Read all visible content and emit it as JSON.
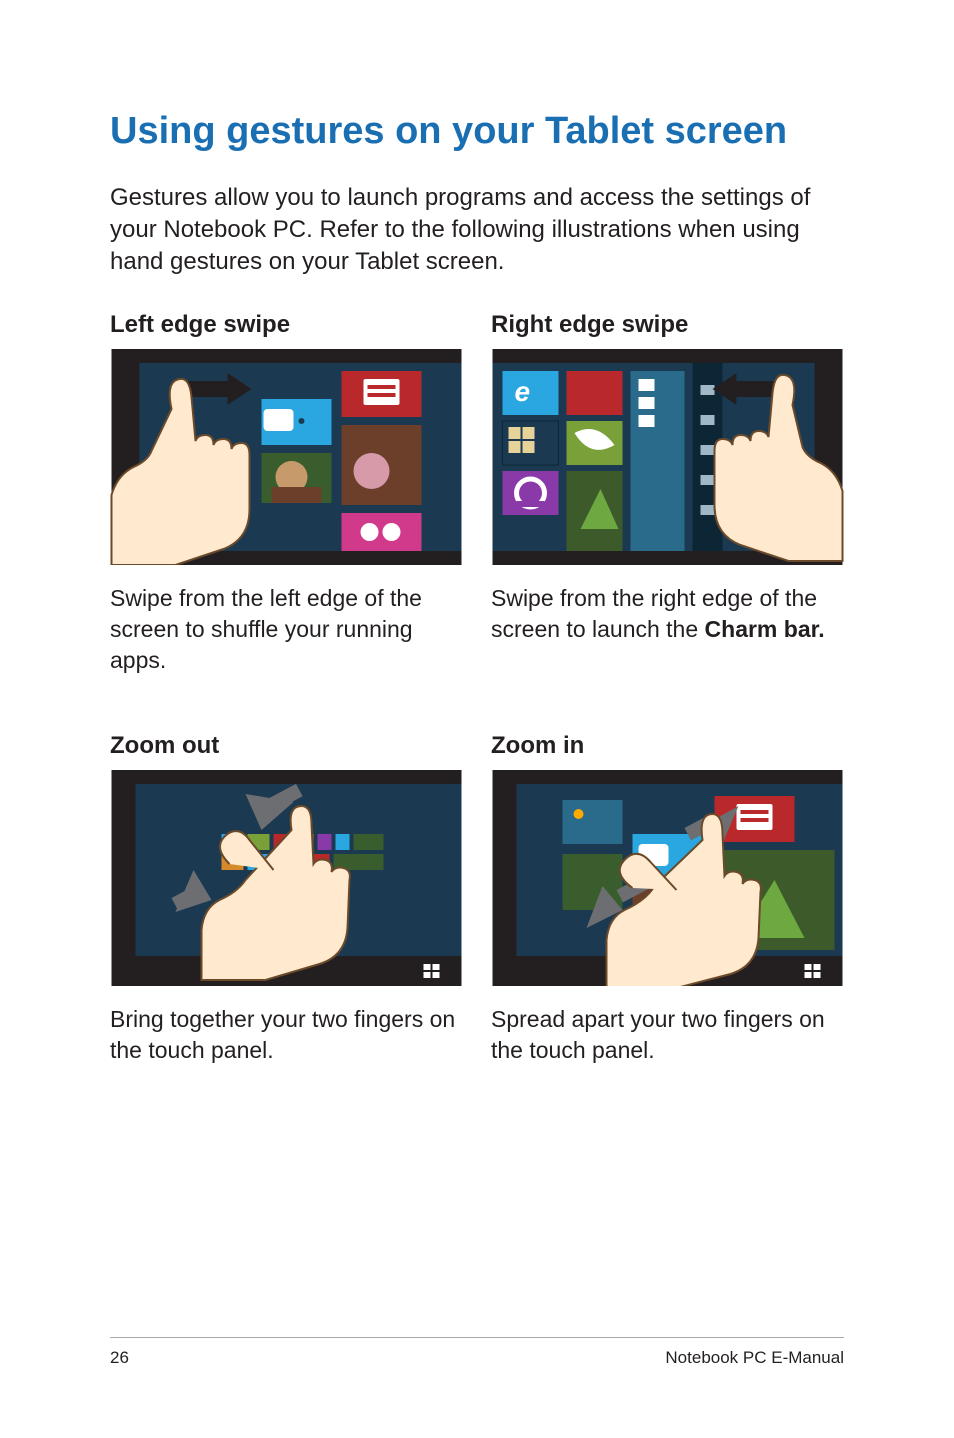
{
  "title": "Using gestures on your Tablet screen",
  "intro": "Gestures allow you to launch programs and access the settings of your Notebook PC. Refer to the following illustrations when using hand gestures on your Tablet screen.",
  "cells": {
    "left_swipe": {
      "title": "Left edge swipe",
      "desc": "Swipe from the left edge of the screen to shuffle your running apps."
    },
    "right_swipe": {
      "title": "Right edge swipe",
      "desc_prefix": "Swipe from the right edge of the screen to launch the ",
      "desc_bold": "Charm bar."
    },
    "zoom_out": {
      "title": "Zoom out",
      "desc": "Bring together your two fingers on the touch panel."
    },
    "zoom_in": {
      "title": "Zoom in",
      "desc": "Spread apart your two fingers on the touch panel."
    }
  },
  "footer": {
    "page_number": "26",
    "doc_title": "Notebook PC E-Manual"
  }
}
